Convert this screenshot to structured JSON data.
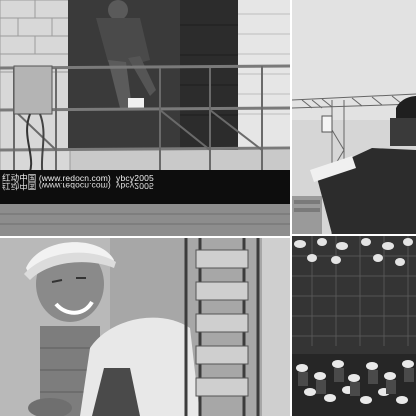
{
  "watermark": {
    "site": "红动中国 (www.redocn.com)",
    "code": "ybcy2005",
    "site_mirrored": "红动中国 (www.redocn.com)",
    "code_mirrored": "ybcy2005"
  },
  "colors": {
    "background": "#ffffff",
    "watermark_bar": "#0d0d0d",
    "watermark_text": "#f2f2f2"
  },
  "photos": [
    {
      "subject": "worker on scaffold beside brick wall"
    },
    {
      "subject": "tower crane and worker pointing"
    },
    {
      "subject": "smiling worker in hard hat with rebar"
    },
    {
      "subject": "crowd of workers in hard hats"
    }
  ]
}
